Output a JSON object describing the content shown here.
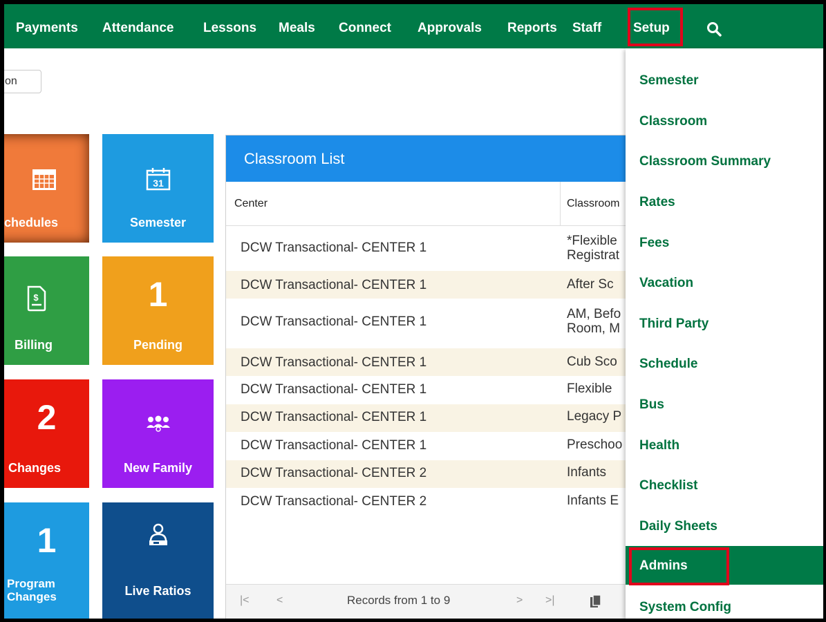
{
  "nav": {
    "items": [
      "Payments",
      "Attendance",
      "Lessons",
      "Meals",
      "Connect",
      "Approvals",
      "Reports",
      "Staff",
      "Setup"
    ],
    "bg_color": "#007a47",
    "highlight_color": "#e1061c",
    "search_icon": "search-icon"
  },
  "search_input": {
    "value": "on"
  },
  "tiles": {
    "schedules": {
      "label": "chedules",
      "color": "#f07a3a",
      "icon": "calendar-grid-icon"
    },
    "semester": {
      "label": "Semester",
      "color": "#1e9be0",
      "icon": "calendar-31-icon",
      "icon_text": "31"
    },
    "billing": {
      "label": "Billing",
      "color": "#2f9e44",
      "icon": "invoice-icon"
    },
    "pending": {
      "label": "Pending",
      "number": "1",
      "color": "#f0a01c"
    },
    "changes": {
      "label": "Changes",
      "number": "2",
      "color": "#e8180c"
    },
    "new_family": {
      "label": "New Family",
      "color": "#9b1ef0",
      "icon": "family-group-icon"
    },
    "program_changes": {
      "label_line1": "Program",
      "label_line2": "Changes",
      "number": "1",
      "color": "#1e9be0"
    },
    "live_ratios": {
      "label": "Live Ratios",
      "color": "#0f4e8c",
      "icon": "teacher-icon"
    }
  },
  "classroom_list": {
    "title": "Classroom List",
    "header_color": "#1c8ce8",
    "columns": [
      "Center",
      "Classroom"
    ],
    "rows": [
      {
        "center": "DCW Transactional- CENTER 1",
        "classroom_line1": "*Flexible",
        "classroom_line2": "Registrat"
      },
      {
        "center": "DCW Transactional- CENTER 1",
        "classroom_line1": "After Sc",
        "classroom_line2": ""
      },
      {
        "center": "DCW Transactional- CENTER 1",
        "classroom_line1": "AM, Befo",
        "classroom_line2": "Room, M"
      },
      {
        "center": "DCW Transactional- CENTER 1",
        "classroom_line1": "Cub Sco",
        "classroom_line2": ""
      },
      {
        "center": "DCW Transactional- CENTER 1",
        "classroom_line1": "Flexible",
        "classroom_line2": ""
      },
      {
        "center": "DCW Transactional- CENTER 1",
        "classroom_line1": "Legacy P",
        "classroom_line2": ""
      },
      {
        "center": "DCW Transactional- CENTER 1",
        "classroom_line1": "Preschoo",
        "classroom_line2": ""
      },
      {
        "center": "DCW Transactional- CENTER 2",
        "classroom_line1": "Infants",
        "classroom_line2": ""
      },
      {
        "center": "DCW Transactional- CENTER 2",
        "classroom_line1": "Infants E",
        "classroom_line2": ""
      }
    ],
    "pager": {
      "first": "|<",
      "prev": "<",
      "records_text": "Records from 1 to 9",
      "next": ">",
      "last": ">|",
      "export_icon": "copy-icon"
    }
  },
  "setup_menu": {
    "items": [
      "Semester",
      "Classroom",
      "Classroom Summary",
      "Rates",
      "Fees",
      "Vacation",
      "Third Party",
      "Schedule",
      "Bus",
      "Health",
      "Checklist",
      "Daily Sheets",
      "Admins",
      "System Config"
    ],
    "selected": "Admins"
  }
}
